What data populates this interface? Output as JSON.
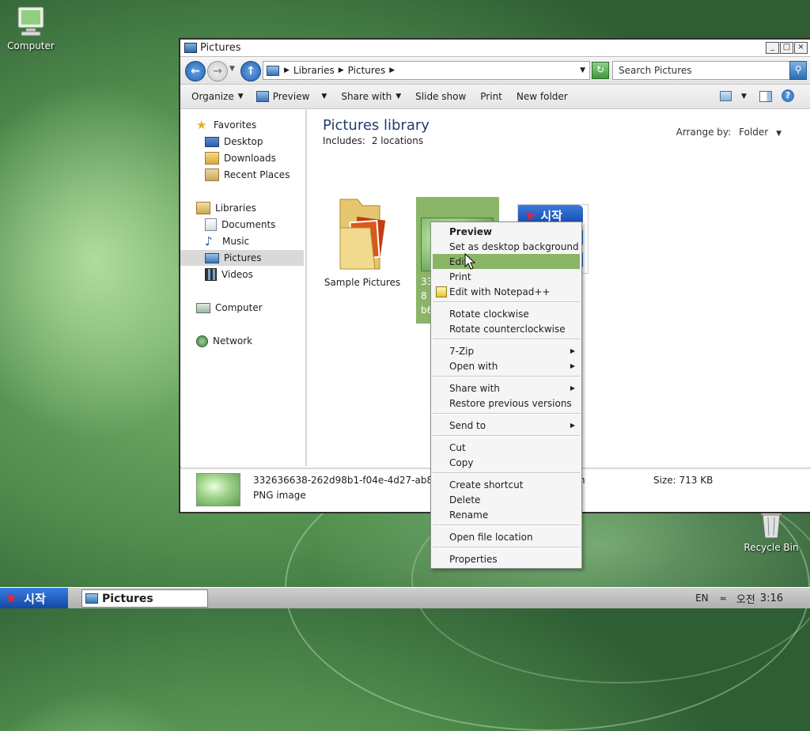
{
  "desktop": {
    "computer_label": "Computer",
    "recycle_label": "Recycle Bin"
  },
  "window": {
    "title": "Pictures",
    "controls": {
      "minimize": "_",
      "maximize": "□",
      "close": "×"
    }
  },
  "address": {
    "crumbs": [
      "Libraries",
      "Pictures"
    ],
    "search_placeholder": "Search Pictures"
  },
  "toolbar": {
    "organize": "Organize",
    "preview": "Preview",
    "share_with": "Share with",
    "slide_show": "Slide show",
    "print": "Print",
    "new_folder": "New folder"
  },
  "nav": {
    "favorites": "Favorites",
    "desktop": "Desktop",
    "downloads": "Downloads",
    "recent_places": "Recent Places",
    "libraries": "Libraries",
    "documents": "Documents",
    "music": "Music",
    "pictures": "Pictures",
    "videos": "Videos",
    "computer": "Computer",
    "network": "Network"
  },
  "library": {
    "title": "Pictures library",
    "includes_label": "Includes:",
    "includes_value": "2 locations",
    "arrange_label": "Arrange by:",
    "arrange_value": "Folder"
  },
  "items": {
    "sample_pictures": "Sample Pictures",
    "selected_caption": [
      "33",
      "8",
      "b6"
    ],
    "start_text": "시작"
  },
  "details": {
    "filename": "332636638-262d98b1-f04e-4d27-ab89",
    "filename_tail": "n",
    "type": "PNG image",
    "size": "Size: 713 KB"
  },
  "context_menu": {
    "preview": "Preview",
    "set_background": "Set as desktop background",
    "edit": "Edit",
    "print": "Print",
    "edit_notepad": "Edit with Notepad++",
    "rotate_cw": "Rotate clockwise",
    "rotate_ccw": "Rotate counterclockwise",
    "seven_zip": "7-Zip",
    "open_with": "Open with",
    "share_with": "Share with",
    "restore_versions": "Restore previous versions",
    "send_to": "Send to",
    "cut": "Cut",
    "copy": "Copy",
    "create_shortcut": "Create shortcut",
    "delete": "Delete",
    "rename": "Rename",
    "open_location": "Open file location",
    "properties": "Properties"
  },
  "taskbar": {
    "start_label": "시작",
    "task_label": "Pictures",
    "lang": "EN",
    "ampm": "오전",
    "time": "3:16"
  },
  "colors": {
    "menu_highlight": "#8ab567",
    "selection_green": "#8ab567",
    "title_blue": "#1e3d70"
  }
}
